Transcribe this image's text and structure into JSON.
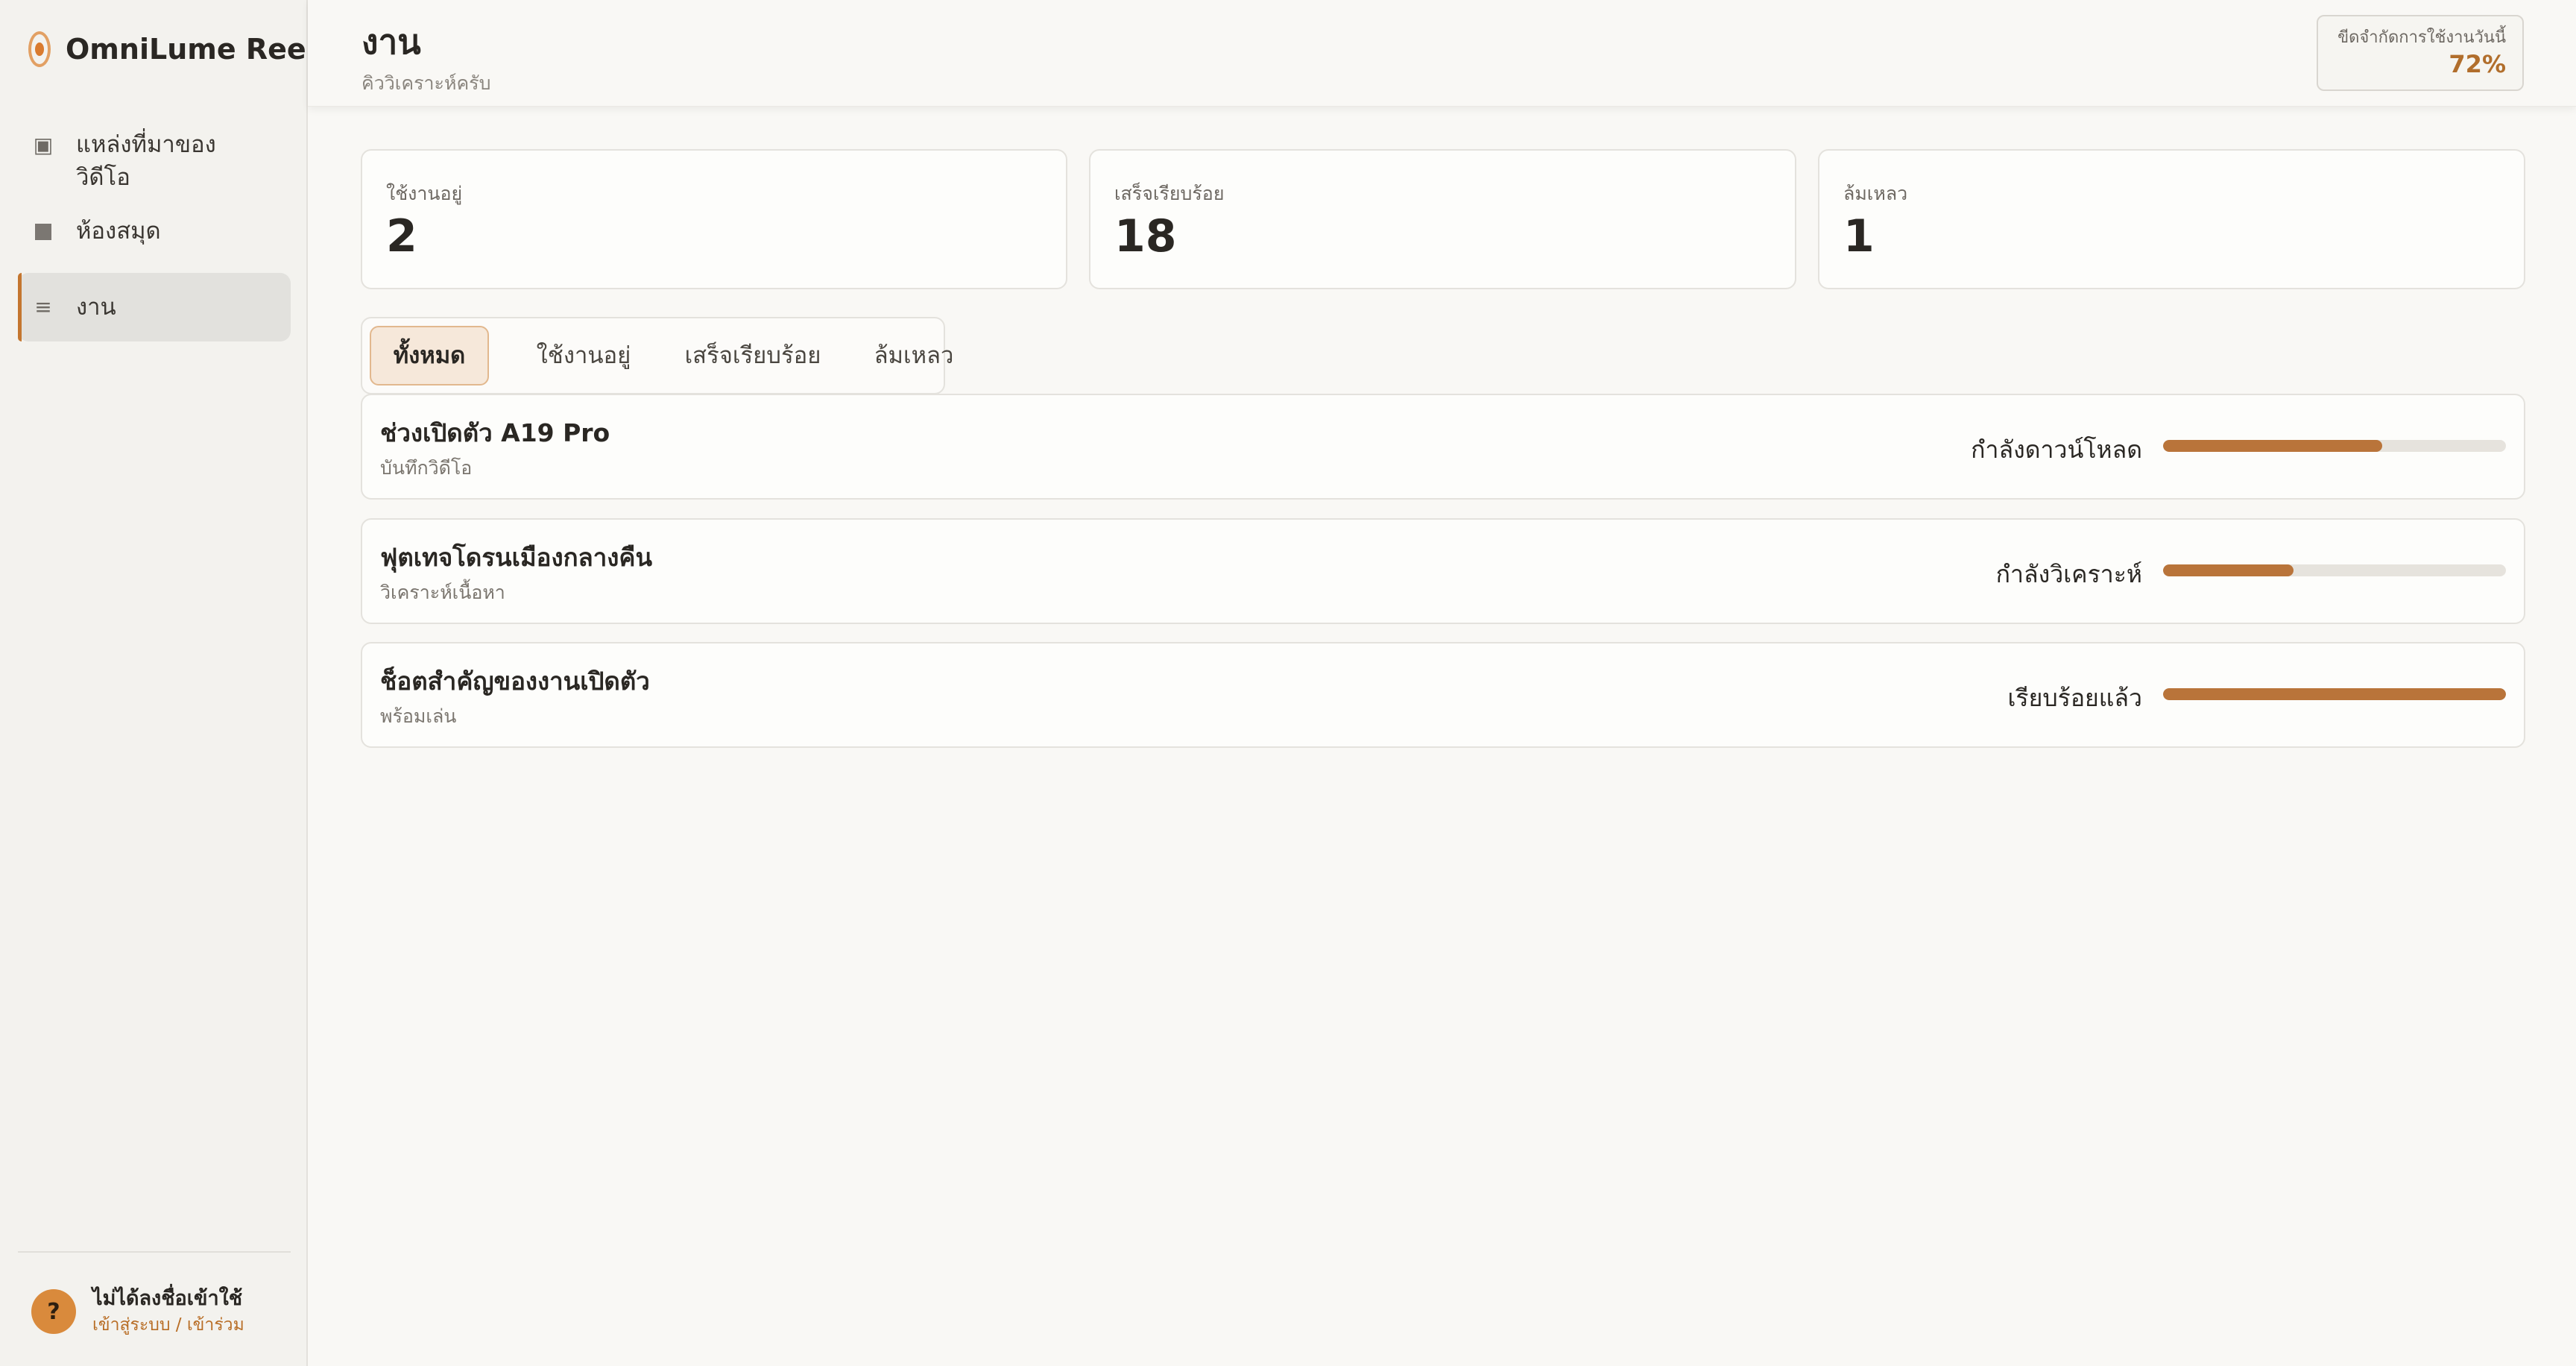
{
  "brand": {
    "name": "OmniLume Reel"
  },
  "sidebar": {
    "items": [
      {
        "label": "แหล่งที่มาของวิดีโอ",
        "icon": "video-square-icon"
      },
      {
        "label": "ห้องสมุด",
        "icon": "square-icon"
      },
      {
        "label": "งาน",
        "icon": "list-icon",
        "active": true
      }
    ],
    "user": {
      "avatar": "?",
      "name": "ไม่ได้ลงชื่อเข้าใช้",
      "links": "เข้าสู่ระบบ / เข้าร่วม"
    }
  },
  "header": {
    "title": "งาน",
    "subtitle": "คิววิเคราะห์ครับ",
    "quota": {
      "label": "ขีดจำกัดการใช้งานวันนี้",
      "value": "72%"
    }
  },
  "stats": [
    {
      "label": "ใช้งานอยู่",
      "value": "2"
    },
    {
      "label": "เสร็จเรียบร้อย",
      "value": "18"
    },
    {
      "label": "ล้มเหลว",
      "value": "1"
    }
  ],
  "tabs": [
    {
      "label": "ทั้งหมด",
      "active": true
    },
    {
      "label": "ใช้งานอยู่"
    },
    {
      "label": "เสร็จเรียบร้อย"
    },
    {
      "label": "ล้มเหลว"
    }
  ],
  "jobs": [
    {
      "title": "ช่วงเปิดตัว A19 Pro",
      "sub": "บันทึกวิดีโอ",
      "status": "กำลังดาวน์โหลด",
      "progress": 0.64
    },
    {
      "title": "ฟุตเทจโดรนเมืองกลางคืน",
      "sub": "วิเคราะห์เนื้อหา",
      "status": "กำลังวิเคราะห์",
      "progress": 0.38
    },
    {
      "title": "ช็อตสำคัญของงานเปิดตัว",
      "sub": "พร้อมเล่น",
      "status": "เรียบร้อยแล้ว",
      "progress": 1.0
    }
  ],
  "colors": {
    "accent": "#c4762f",
    "progress": "#b9743a",
    "track": "#e6e3dd"
  }
}
